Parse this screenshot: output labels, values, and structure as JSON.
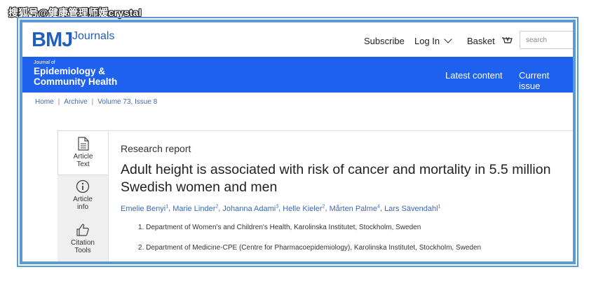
{
  "watermark": "搜狐号@健康管理师媛crystal",
  "header": {
    "logo": "BMJ",
    "logo_suffix": "Journals",
    "subscribe": "Subscribe",
    "login": "Log In",
    "basket": "Basket",
    "search_placeholder": "search"
  },
  "journal": {
    "journal_of": "Journal of",
    "name_line1": "Epidemiology &",
    "name_line2": "Community Health",
    "nav": [
      "Latest content",
      "Current issue"
    ]
  },
  "breadcrumb": [
    "Home",
    "Archive",
    "Volume 73, Issue 8"
  ],
  "side_rail": [
    {
      "line1": "Article",
      "line2": "Text",
      "icon": "document-icon"
    },
    {
      "line1": "Article",
      "line2": "info",
      "icon": "info-icon"
    },
    {
      "line1": "Citation",
      "line2": "Tools",
      "icon": "thumbs-up-icon"
    }
  ],
  "article": {
    "type": "Research report",
    "title": "Adult height is associated with risk of cancer and mortality in 5.5 million Swedish women and men",
    "authors": [
      {
        "name": "Emelie Benyi",
        "sup": "1"
      },
      {
        "name": "Marie Linder",
        "sup": "2"
      },
      {
        "name": "Johanna Adami",
        "sup": "3"
      },
      {
        "name": "Helle Kieler",
        "sup": "2"
      },
      {
        "name": "Mårten Palme",
        "sup": "4"
      },
      {
        "name": "Lars Sävendahl",
        "sup": "1"
      }
    ],
    "affiliations": [
      "1. Department of Women's and Children's Health, Karolinska Institutet, Stockholm, Sweden",
      "2. Department of Medicine-CPE (Centre for Pharmacoepidemiology), Karolinska Institutet, Stockholm, Sweden"
    ]
  },
  "colors": {
    "frame": "#5b9bd5",
    "brand_blue": "#1f61ef",
    "link": "#3d6ab0"
  }
}
